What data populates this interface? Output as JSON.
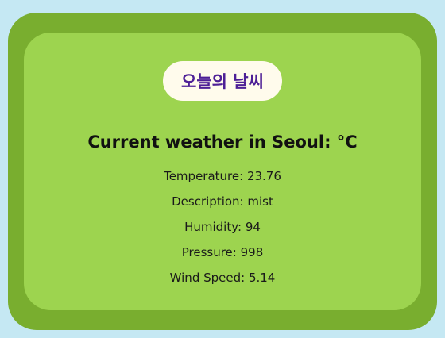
{
  "page": {
    "colors": {
      "background": "#c5e8f3",
      "outer_card": "#79ae2f",
      "inner_card": "#9dd44f",
      "pill": "#fffbec",
      "pill_text": "#4d1f96"
    }
  },
  "badge": {
    "title": "오늘의 날씨"
  },
  "weather": {
    "heading_prefix": "Current weather in ",
    "city": "Seoul",
    "heading_suffix": ": °C",
    "temperature_label": "Temperature: ",
    "temperature": "23.76",
    "description_label": "Description: ",
    "description": "mist",
    "humidity_label": "Humidity: ",
    "humidity": "94",
    "pressure_label": "Pressure: ",
    "pressure": "998",
    "wind_label": "Wind Speed: ",
    "wind_speed": "5.14"
  }
}
